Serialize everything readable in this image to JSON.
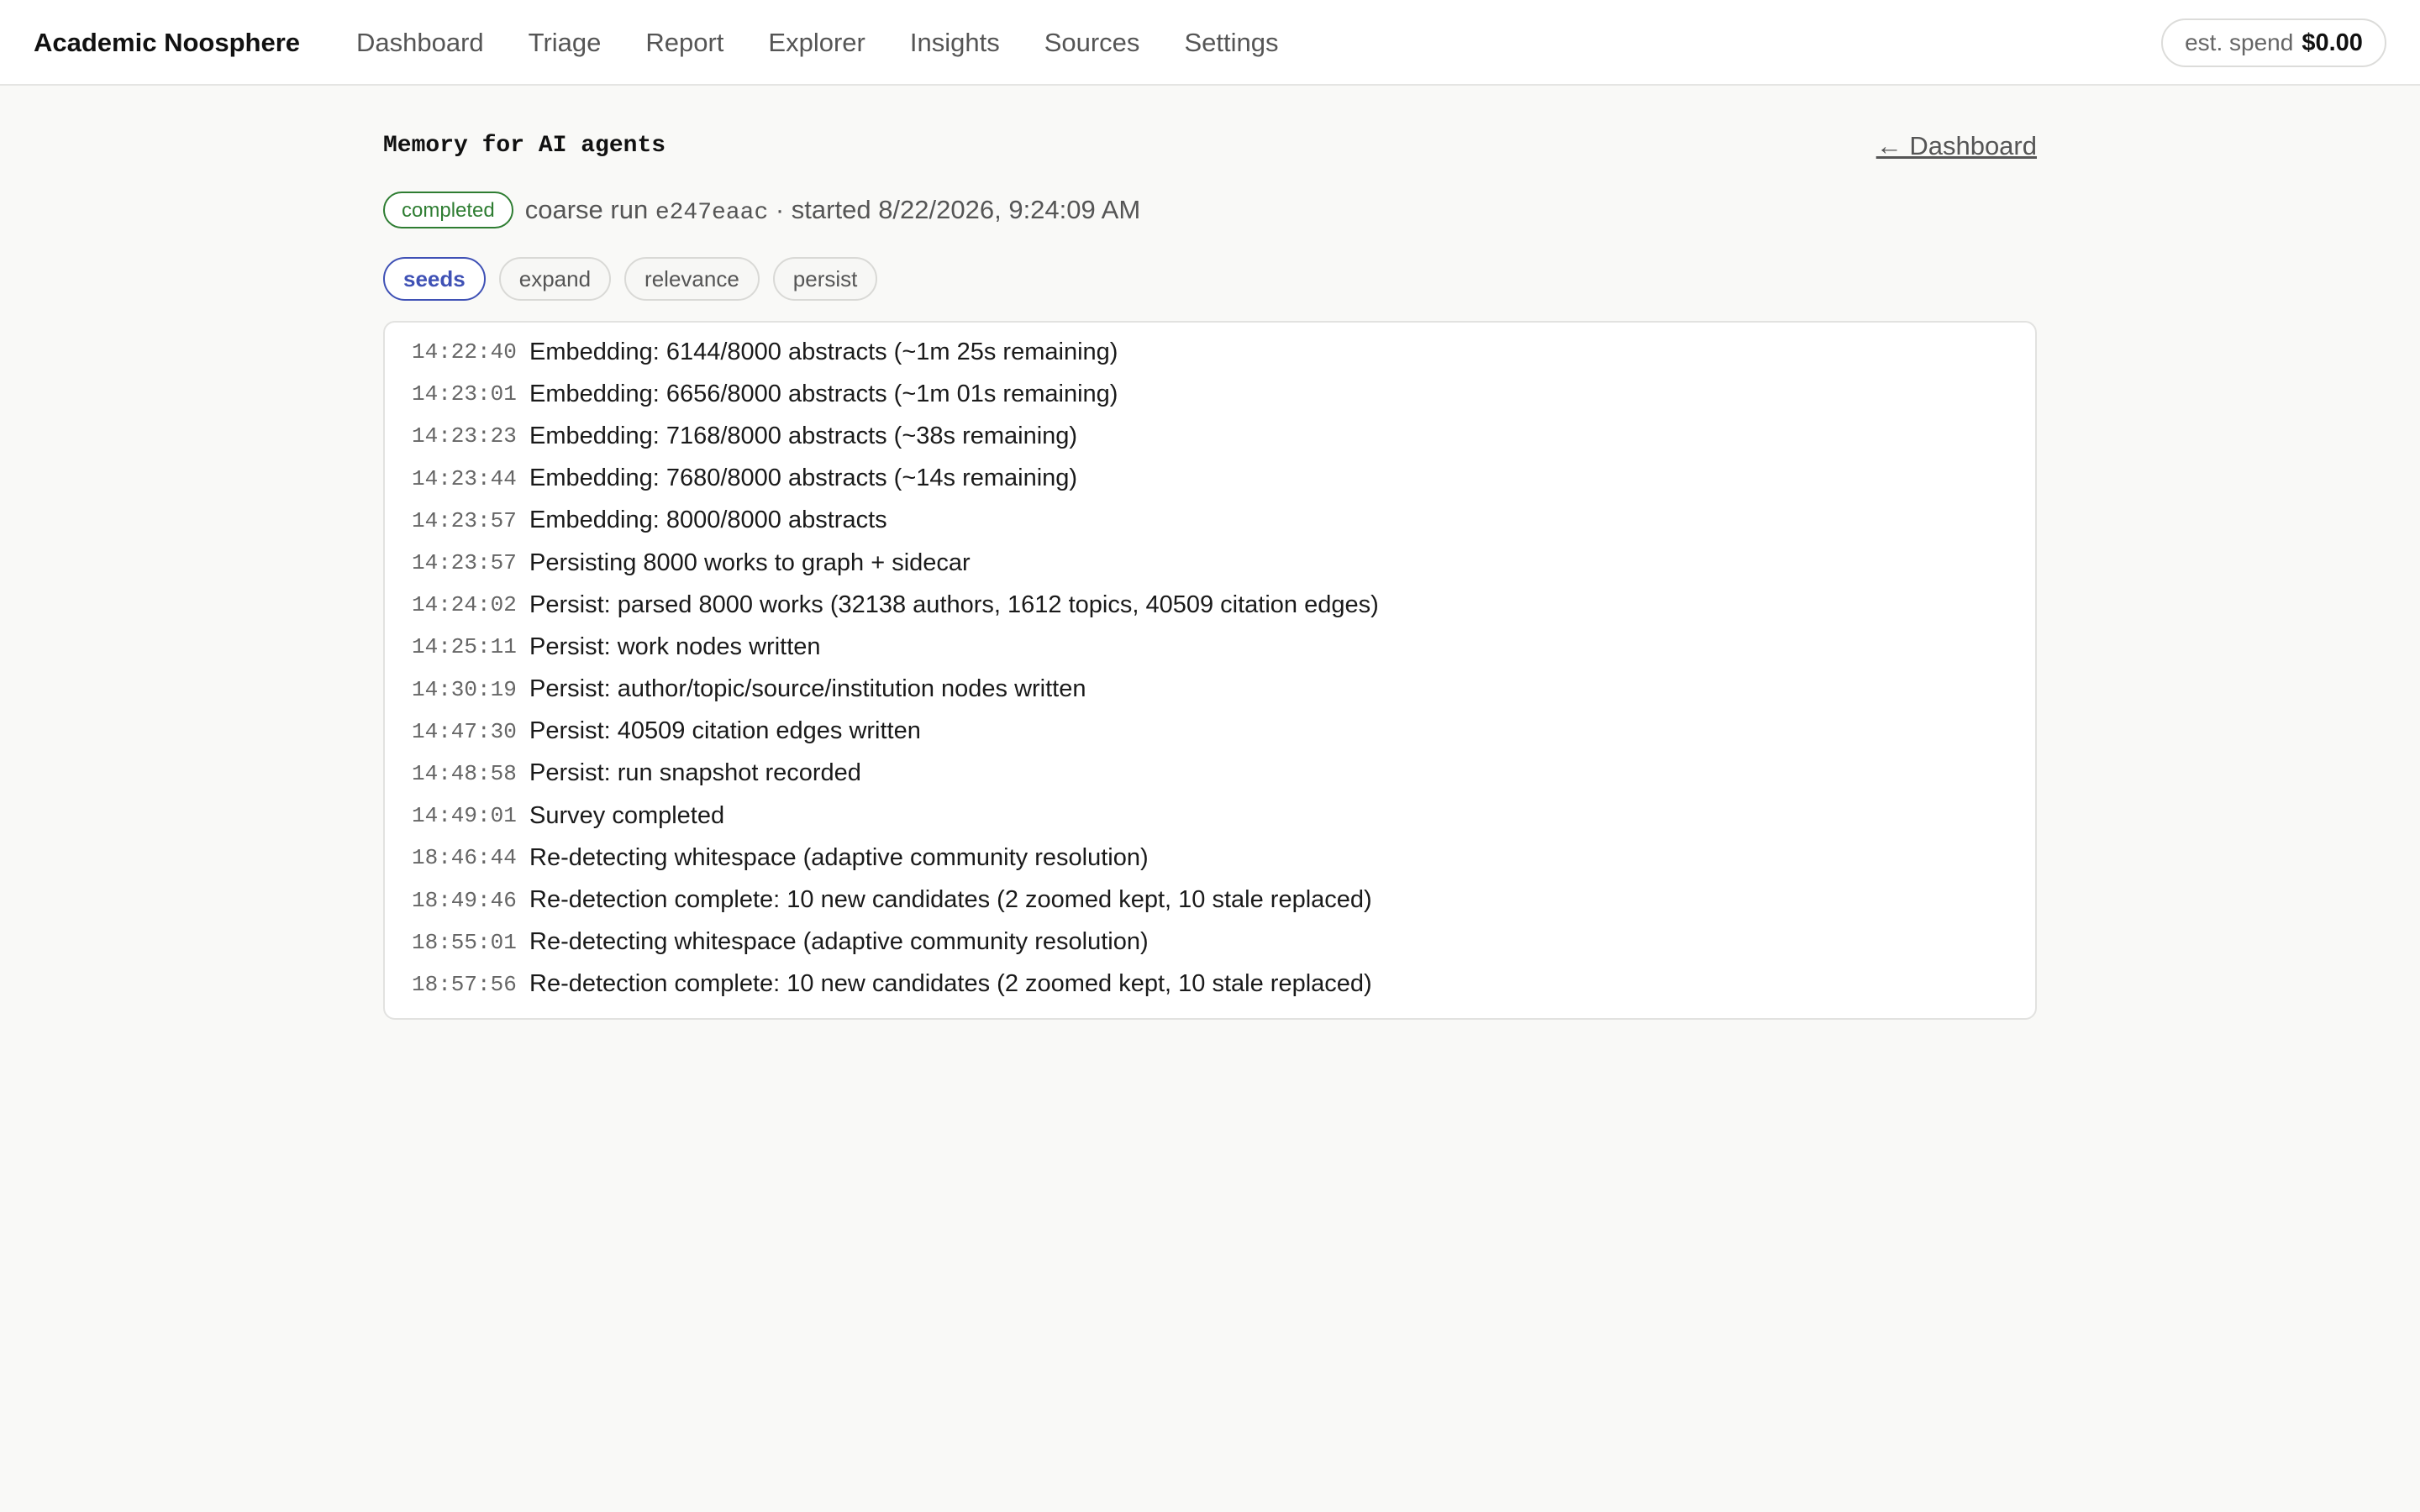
{
  "app": {
    "brand": "Academic Noosphere",
    "nav": [
      "Dashboard",
      "Triage",
      "Report",
      "Explorer",
      "Insights",
      "Sources",
      "Settings"
    ],
    "spend_label": "est. spend",
    "spend_value": "$0.00"
  },
  "page": {
    "title": "Memory for AI agents",
    "back_link": "← Dashboard",
    "status": "completed",
    "run_prefix": "coarse run",
    "run_id": "e247eaac",
    "run_started": "· started 8/22/2026, 9:24:09 AM"
  },
  "stages": [
    {
      "label": "seeds",
      "active": true
    },
    {
      "label": "expand",
      "active": false
    },
    {
      "label": "relevance",
      "active": false
    },
    {
      "label": "persist",
      "active": false
    }
  ],
  "log": [
    {
      "time": "14:22:40",
      "message": "Embedding: 6144/8000 abstracts (~1m 25s remaining)"
    },
    {
      "time": "14:23:01",
      "message": "Embedding: 6656/8000 abstracts (~1m 01s remaining)"
    },
    {
      "time": "14:23:23",
      "message": "Embedding: 7168/8000 abstracts (~38s remaining)"
    },
    {
      "time": "14:23:44",
      "message": "Embedding: 7680/8000 abstracts (~14s remaining)"
    },
    {
      "time": "14:23:57",
      "message": "Embedding: 8000/8000 abstracts"
    },
    {
      "time": "14:23:57",
      "message": "Persisting 8000 works to graph + sidecar"
    },
    {
      "time": "14:24:02",
      "message": "Persist: parsed 8000 works (32138 authors, 1612 topics, 40509 citation edges)"
    },
    {
      "time": "14:25:11",
      "message": "Persist: work nodes written"
    },
    {
      "time": "14:30:19",
      "message": "Persist: author/topic/source/institution nodes written"
    },
    {
      "time": "14:47:30",
      "message": "Persist: 40509 citation edges written"
    },
    {
      "time": "14:48:58",
      "message": "Persist: run snapshot recorded"
    },
    {
      "time": "14:49:01",
      "message": "Survey completed"
    },
    {
      "time": "18:46:44",
      "message": "Re-detecting whitespace (adaptive community resolution)"
    },
    {
      "time": "18:49:46",
      "message": "Re-detection complete: 10 new candidates (2 zoomed kept, 10 stale replaced)"
    },
    {
      "time": "18:55:01",
      "message": "Re-detecting whitespace (adaptive community resolution)"
    },
    {
      "time": "18:57:56",
      "message": "Re-detection complete: 10 new candidates (2 zoomed kept, 10 stale replaced)"
    }
  ]
}
